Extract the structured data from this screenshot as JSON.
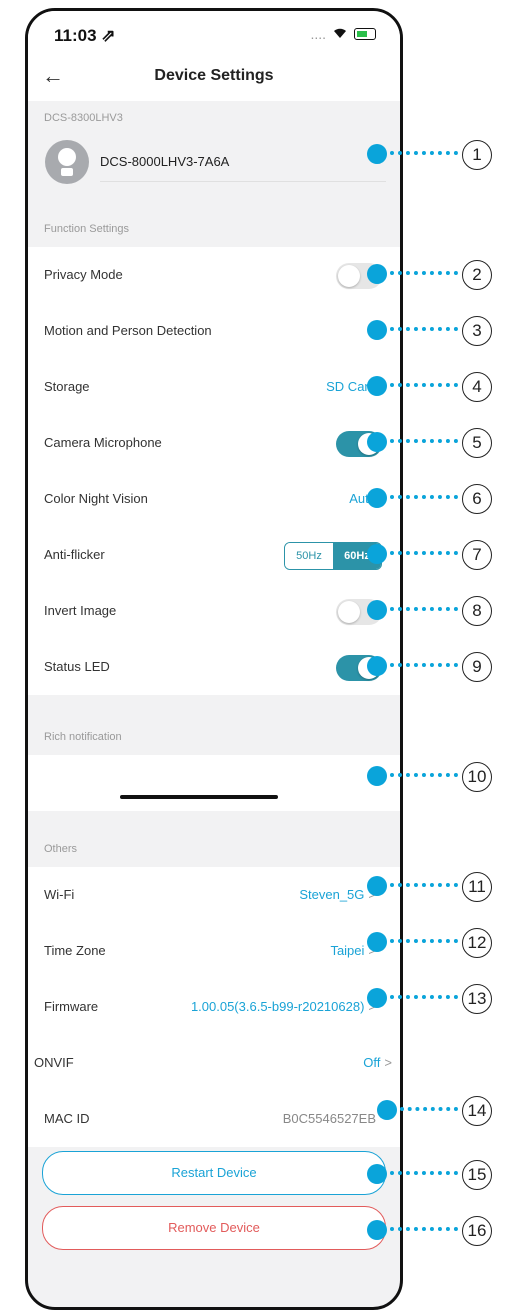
{
  "status_bar": {
    "time": "11:03 ⇗",
    "signal": "....",
    "wifi": "wifi-icon",
    "battery": "battery-icon"
  },
  "header": {
    "back_icon": "←",
    "title": "Device Settings"
  },
  "device": {
    "model_label": "DCS-8300LHV3",
    "name": "DCS-8000LHV3-7A6A",
    "edit_icon": "pencil-icon"
  },
  "function_settings": {
    "section_label": "Function Settings",
    "rows": [
      {
        "label": "Privacy Mode",
        "control": "toggle",
        "on": false
      },
      {
        "label": "Motion and Person Detection",
        "control": "none"
      },
      {
        "label": "Storage",
        "value": "SD Card"
      },
      {
        "label": "Camera Microphone",
        "control": "toggle",
        "on": true
      },
      {
        "label": "Color Night Vision",
        "value": "Auto"
      },
      {
        "label": "Anti-flicker",
        "options": [
          "50Hz",
          "60Hz"
        ],
        "selected": "60Hz"
      },
      {
        "label": "Invert Image",
        "control": "toggle",
        "on": false
      },
      {
        "label": "Status LED",
        "control": "toggle",
        "on": true
      }
    ]
  },
  "rich_notification": {
    "section_label": "Rich notification"
  },
  "others": {
    "section_label": "Others",
    "rows": [
      {
        "label": "Wi-Fi",
        "value": "Steven_5G",
        "chevron": ">"
      },
      {
        "label": "Time Zone",
        "value": "Taipei",
        "chevron": ">"
      },
      {
        "label": "Firmware",
        "value": "1.00.05(3.6.5-b99-r20210628)",
        "chevron": ">"
      },
      {
        "label": "ONVIF",
        "value": "Off",
        "chevron": ">"
      },
      {
        "label": "MAC ID",
        "value": "B0C5546527EB"
      }
    ]
  },
  "buttons": {
    "restart": "Restart Device",
    "remove": "Remove Device"
  },
  "callouts": [
    "1",
    "2",
    "3",
    "4",
    "5",
    "6",
    "7",
    "8",
    "9",
    "10",
    "11",
    "12",
    "13",
    "14",
    "15",
    "16"
  ],
  "colors": {
    "accent": "#1aa3d6",
    "toggle_on": "#2c93a8",
    "danger": "#e25b5b",
    "callout": "#0aa4da"
  }
}
